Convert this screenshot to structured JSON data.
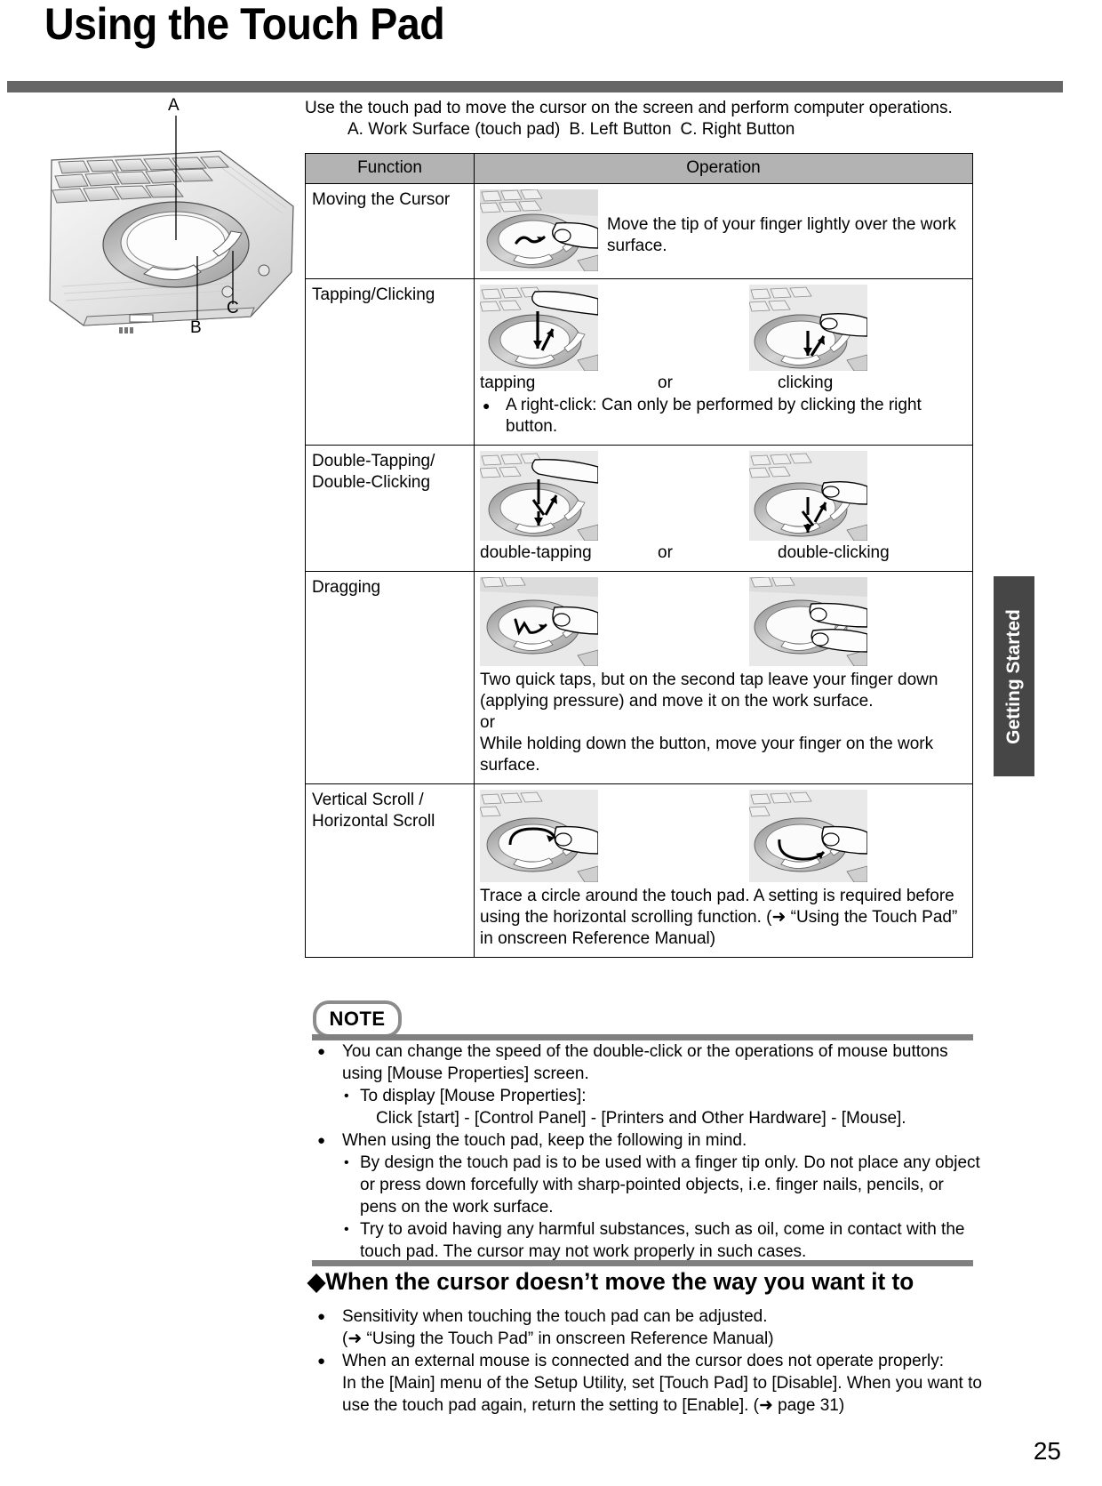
{
  "document": {
    "title": "Using the Touch Pad",
    "page_number": "25",
    "side_tab": "Getting Started"
  },
  "intro": {
    "line1": "Use the touch pad to move the cursor on the screen and perform computer operations.",
    "legend_a": "A. Work Surface (touch pad)",
    "legend_b": "B. Left Button",
    "legend_c": "C. Right Button"
  },
  "figure": {
    "label_a": "A",
    "label_b": "B",
    "label_c": "C",
    "caption": "laptop touch pad illustration"
  },
  "table": {
    "headers": [
      "Function",
      "Operation"
    ],
    "rows": [
      {
        "function": "Moving the Cursor",
        "text": "Move the tip of your finger lightly over the work surface.",
        "images": [
          "moving-cursor-photo"
        ]
      },
      {
        "function": "Tapping/Clicking",
        "caption_left": "tapping",
        "caption_mid": "or",
        "caption_right": "clicking",
        "bullet": "A right-click: Can only be performed by clicking the right but-ton.",
        "bullet_text": "A right-click: Can only be performed by clicking the right button.",
        "images": [
          "tapping-photo",
          "clicking-photo"
        ]
      },
      {
        "function": "Double-Tapping/ Double-Clicking",
        "function_line1": "Double-Tapping/",
        "function_line2": "Double-Clicking",
        "caption_left": "double-tapping",
        "caption_mid": "or",
        "caption_right": "double-clicking",
        "images": [
          "double-tapping-photo",
          "double-clicking-photo"
        ]
      },
      {
        "function": "Dragging",
        "text": "Two quick taps, but on the second tap leave your finger down (applying pressure) and move it on the work surface.",
        "text_or": "or",
        "text2": "While holding down the button, move your finger on the work surface.",
        "images": [
          "drag-tap-photo",
          "drag-button-photo"
        ]
      },
      {
        "function": "Vertical Scroll / Horizontal Scroll",
        "function_line1": "Vertical Scroll /",
        "function_line2": "Horizontal Scroll",
        "text": "Trace a circle around the touch pad. A setting is required before using the horizontal scrolling function. (➜ “Using the Touch Pad” in onscreen Reference Manual)",
        "images": [
          "vertical-scroll-photo",
          "horizontal-scroll-photo"
        ]
      }
    ]
  },
  "note": {
    "badge": "NOTE",
    "items": [
      {
        "bullet": "●",
        "text": "You can change the speed of the double-click or the operations of mouse buttons using [Mouse Properties] screen.",
        "sub": [
          {
            "bullet": "•",
            "text": "To display [Mouse Properties]:",
            "cont": "Click [start] - [Control Panel] - [Printers and Other Hardware] - [Mouse]."
          }
        ]
      },
      {
        "bullet": "●",
        "text": "When using the touch pad, keep the following in mind.",
        "sub": [
          {
            "bullet": "•",
            "text": "By design the touch pad is to be used with a finger tip only. Do not place any object or press down forcefully with sharp-pointed objects, i.e. finger nails, pencils, or pens on the work surface."
          },
          {
            "bullet": "•",
            "text": "Try to avoid having any harmful substances, such as oil, come in contact with the touch pad. The cursor may not work properly in such cases."
          }
        ]
      }
    ]
  },
  "section": {
    "heading": "◆When the cursor doesn’t move the way you want it to",
    "items": [
      {
        "bullet": "●",
        "text": "Sensitivity when touching the touch pad can be adjusted.",
        "cont": "(➜ “Using the Touch Pad” in onscreen Reference Manual)"
      },
      {
        "bullet": "●",
        "text": "When an external mouse is connected and the cursor does not operate properly:",
        "cont": "In the [Main] menu of the Setup Utility, set [Touch Pad] to [Disable]. When you want to use the touch pad again, return the setting to [Enable]. (➜ page 31)"
      }
    ]
  }
}
